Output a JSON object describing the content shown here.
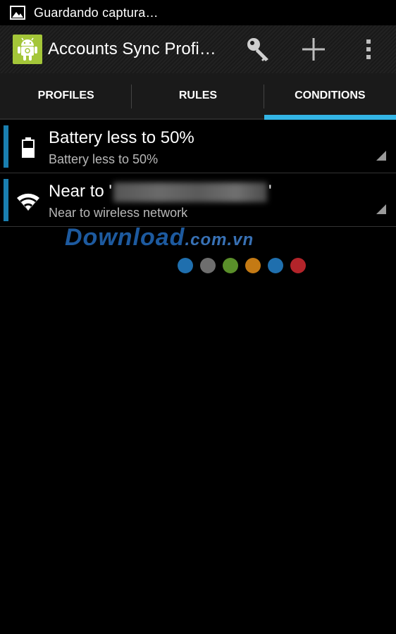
{
  "status_bar": {
    "text": "Guardando captura…",
    "icon": "image-icon"
  },
  "action_bar": {
    "title": "Accounts Sync Profi…",
    "app_icon": "android-icon",
    "actions": [
      {
        "name": "key-icon"
      },
      {
        "name": "add-icon"
      },
      {
        "name": "overflow-menu-icon"
      }
    ]
  },
  "tabs": [
    {
      "label": "PROFILES",
      "selected": false
    },
    {
      "label": "RULES",
      "selected": false
    },
    {
      "label": "CONDITIONS",
      "selected": true
    }
  ],
  "conditions": [
    {
      "title": "Battery less to 50%",
      "subtitle": "Battery less to 50%",
      "icon": "battery-icon"
    },
    {
      "title_prefix": "Near to '",
      "title_suffix": "'",
      "subtitle": "Near to wireless network",
      "icon": "wifi-icon"
    }
  ],
  "watermark": {
    "main": "Download",
    "suffix": ".com.vn",
    "dot_colors": [
      "#1f6fae",
      "#6e6e6e",
      "#5a8f2a",
      "#c47a14",
      "#1f6fae",
      "#b3242a"
    ]
  },
  "colors": {
    "accent": "#33b5e5",
    "item_bar": "#1a7fb0",
    "app_icon_bg": "#a4c639"
  }
}
